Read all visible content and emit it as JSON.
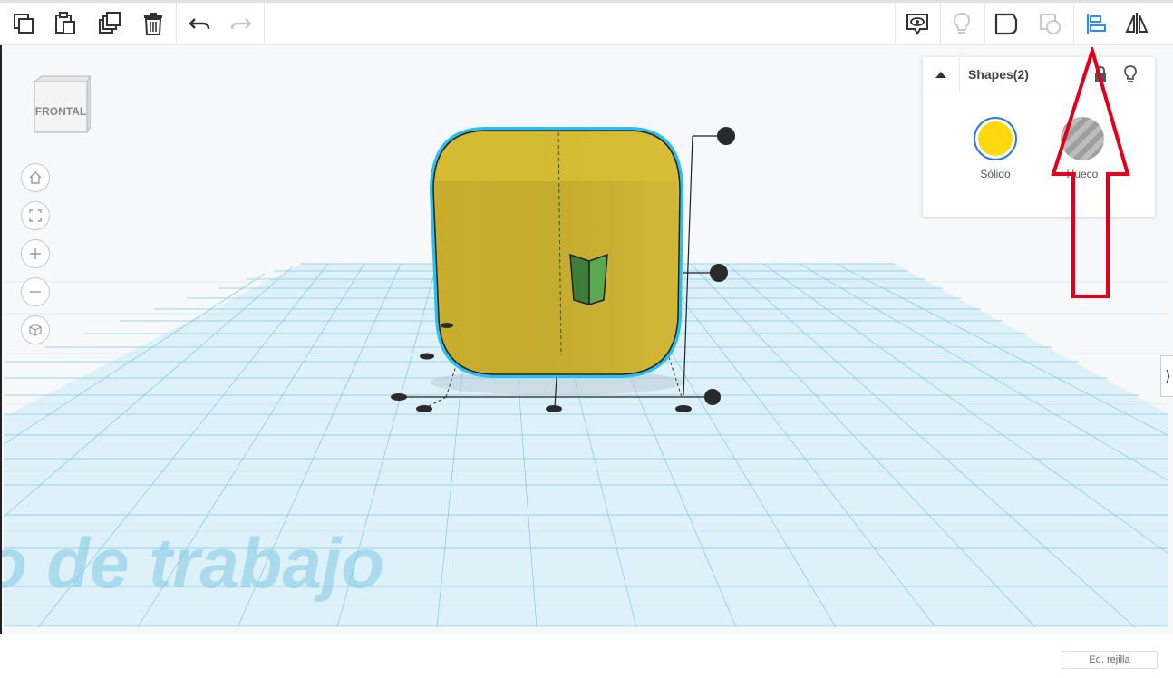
{
  "toolbar": {
    "left_tools": [
      "copy-icon",
      "paste-icon",
      "duplicate-icon",
      "trash-icon",
      "undo-icon",
      "redo-icon"
    ],
    "right_tools": [
      "comment-icon",
      "lightbulb-icon",
      "shape-outline-icon",
      "group-icon",
      "align-icon",
      "mirror-icon"
    ]
  },
  "view_cube": {
    "face_label": "FRONTAL"
  },
  "nav_controls": [
    "home-icon",
    "fit-icon",
    "zoom-in-icon",
    "zoom-out-icon",
    "perspective-icon"
  ],
  "shapes_panel": {
    "title": "Shapes(2)",
    "solid": {
      "label": "Sólido",
      "color": "#ffd810"
    },
    "hole": {
      "label": "Hueco",
      "color": "#bdbdbd"
    }
  },
  "workplane": {
    "watermark": "o de trabajo",
    "grid_color": "#6ec3e6"
  },
  "grid_button": {
    "label": "Ed. rejilla"
  },
  "annotation": {
    "arrow_color": "#e0001b"
  },
  "colors": {
    "accent": "#1e90ff",
    "selection": "#27c0f0"
  }
}
